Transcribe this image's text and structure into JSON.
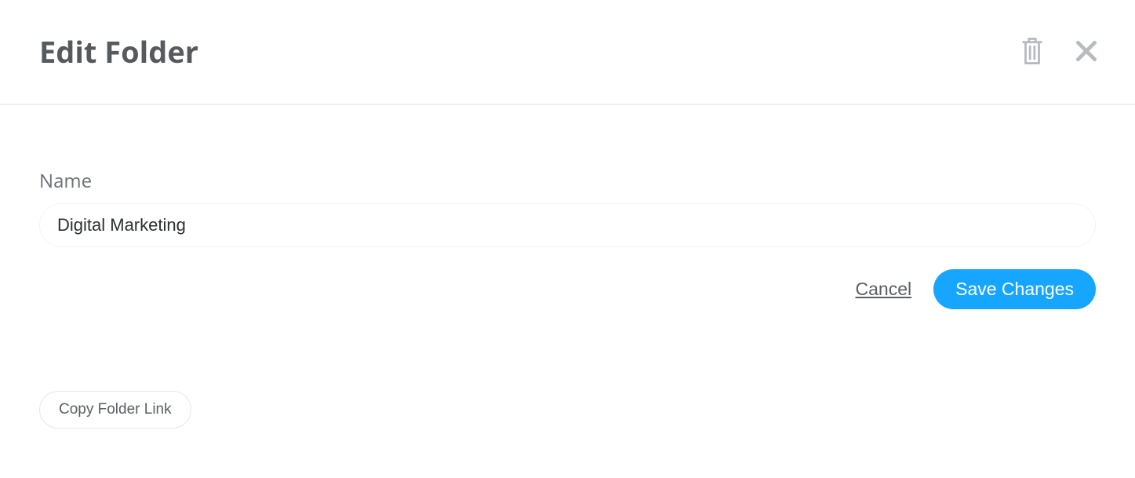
{
  "header": {
    "title": "Edit Folder"
  },
  "form": {
    "name_label": "Name",
    "name_value": "Digital Marketing",
    "cancel_label": "Cancel",
    "save_label": "Save Changes"
  },
  "secondary": {
    "copy_link_label": "Copy Folder Link"
  }
}
